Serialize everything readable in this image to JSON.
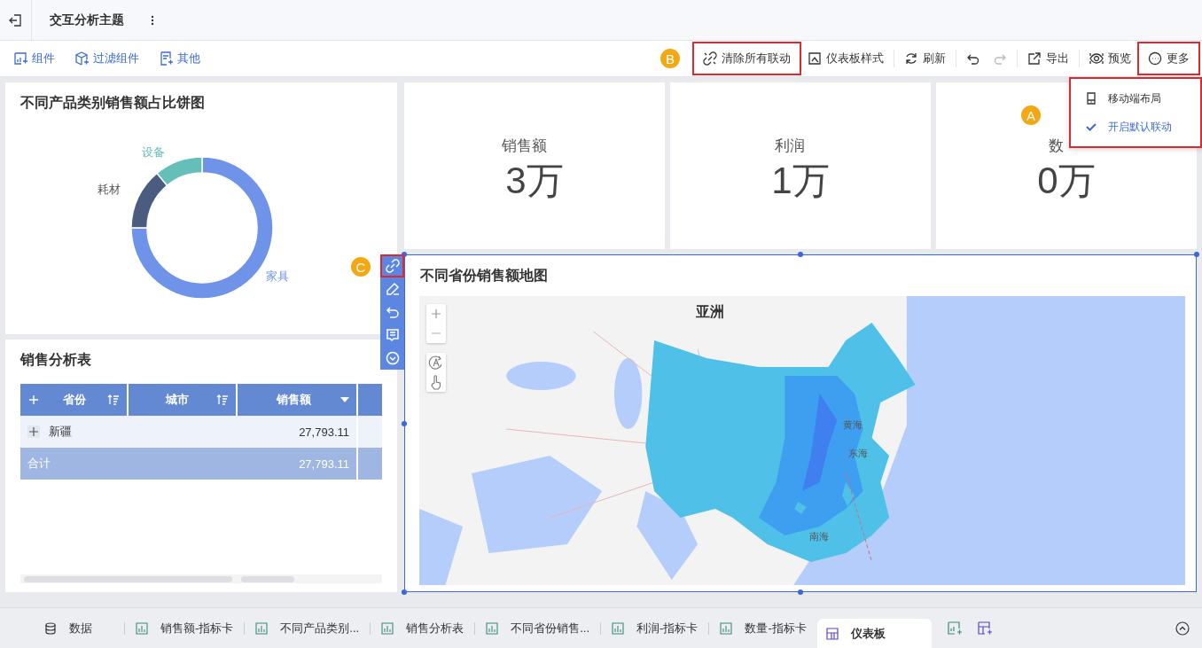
{
  "header": {
    "title": "交互分析主题"
  },
  "toolbar": {
    "left": [
      {
        "label": "组件",
        "kind": "widget"
      },
      {
        "label": "过滤组件",
        "kind": "filter"
      },
      {
        "label": "其他",
        "kind": "other"
      }
    ],
    "badge": "B",
    "right": [
      {
        "kind": "unlink",
        "label": "清除所有联动",
        "highlighted": true,
        "disabled": false
      },
      {
        "kind": "style",
        "label": "仪表板样式",
        "highlighted": false,
        "disabled": false
      },
      {
        "kind": "refresh",
        "label": "刷新",
        "highlighted": false,
        "disabled": false
      },
      {
        "kind": "undo",
        "highlighted": false,
        "disabled": false
      },
      {
        "kind": "redo",
        "highlighted": false,
        "disabled": true
      },
      {
        "kind": "export",
        "label": "导出",
        "highlighted": false,
        "disabled": false
      },
      {
        "kind": "preview",
        "label": "预览",
        "highlighted": false,
        "disabled": false
      },
      {
        "kind": "more",
        "label": "更多",
        "highlighted": true,
        "disabled": false
      }
    ]
  },
  "menu": {
    "badge": "A",
    "items": [
      {
        "label": "移动端布局",
        "kind": "mobile",
        "checked": false
      },
      {
        "label": "开启默认联动",
        "kind": "check",
        "checked": true
      }
    ]
  },
  "pie": {
    "title": "不同产品类别销售额占比饼图",
    "slices": [
      {
        "label": "家具",
        "color": "#6f93e8"
      },
      {
        "label": "耗材",
        "color": "#4a5d80"
      },
      {
        "label": "设备",
        "color": "#64bfb8"
      }
    ]
  },
  "kpis": [
    {
      "label": "销售额",
      "value": "3万"
    },
    {
      "label": "利润",
      "value": "1万"
    },
    {
      "label": "数",
      "value": "0万"
    }
  ],
  "table": {
    "title": "销售分析表",
    "columns": [
      {
        "label": "省份",
        "kind": "sort"
      },
      {
        "label": "城市",
        "kind": "sort"
      },
      {
        "label": "销售额",
        "kind": "dropdown"
      }
    ],
    "rows": [
      {
        "cells": [
          "新疆",
          "",
          "27,793.11"
        ]
      }
    ],
    "total": {
      "label": "合计",
      "value": "27,793.11"
    }
  },
  "map": {
    "title": "不同省份销售额地图",
    "labels": [
      "亚洲",
      "黄海",
      "东海",
      "南海"
    ]
  },
  "float_toolbar": {
    "badge": "C",
    "items": [
      {
        "kind": "link",
        "highlighted": true
      },
      {
        "kind": "edit",
        "highlighted": false
      },
      {
        "kind": "undo",
        "highlighted": false
      },
      {
        "kind": "comment",
        "highlighted": false
      },
      {
        "kind": "collapse",
        "highlighted": false
      }
    ]
  },
  "bottom_tabs": [
    {
      "label": "数据",
      "kind": "data",
      "selected": false
    },
    {
      "label": "销售额-指标卡",
      "kind": "chart",
      "selected": false
    },
    {
      "label": "不同产品类别...",
      "kind": "chart",
      "selected": false
    },
    {
      "label": "销售分析表",
      "kind": "chart",
      "selected": false
    },
    {
      "label": "不同省份销售...",
      "kind": "chart",
      "selected": false
    },
    {
      "label": "利润-指标卡",
      "kind": "chart",
      "selected": false
    },
    {
      "label": "数量-指标卡",
      "kind": "chart",
      "selected": false
    },
    {
      "label": "仪表板",
      "kind": "dashboard",
      "selected": true
    }
  ]
}
